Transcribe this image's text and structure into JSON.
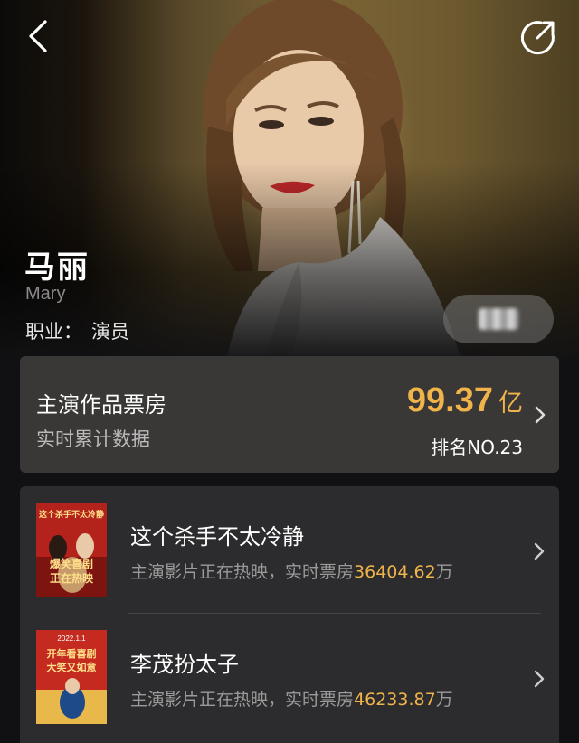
{
  "header": {
    "back_icon": "chevron-left-icon",
    "share_icon": "share-icon"
  },
  "profile": {
    "name": "马丽",
    "name_en": "Mary",
    "profession_label": "职业：",
    "profession_value": "演员"
  },
  "box_office": {
    "title": "主演作品票房",
    "subtitle": "实时累计数据",
    "total_value": "99.37",
    "total_unit": "亿",
    "rank": "排名NO.23"
  },
  "films": [
    {
      "title": "这个杀手不太冷静",
      "desc_prefix": "主演影片正在热映，实时票房",
      "gross": "36404.62",
      "unit": "万",
      "poster_text_top": "这个杀手不太冷静",
      "poster_text_mid1": "爆笑喜剧",
      "poster_text_mid2": "正在热映"
    },
    {
      "title": "李茂扮太子",
      "desc_prefix": "主演影片正在热映，实时票房",
      "gross": "46233.87",
      "unit": "万",
      "poster_text_top": "2022.1.1",
      "poster_text_mid1": "开年看喜剧",
      "poster_text_mid2": "大笑又如意"
    }
  ],
  "colors": {
    "accent": "#f0b44b",
    "card_bg": "#3a3836",
    "list_bg": "#2c2c2e",
    "page_bg": "#111113"
  }
}
